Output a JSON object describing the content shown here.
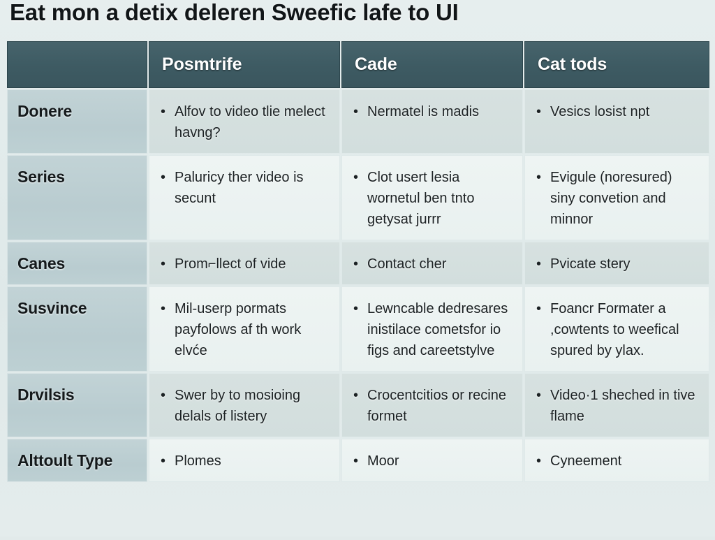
{
  "page": {
    "title": "Eat mon a detix deleren Sweefic lafe to UI",
    "background_color": "#e2eaea",
    "header_color": "#3e5b63",
    "row_label_color": "#bdd0d3",
    "band_dark_color": "#d4e0df",
    "band_light_color": "#ecf3f2"
  },
  "table": {
    "columns": [
      {
        "key": "label",
        "header": ""
      },
      {
        "key": "col1",
        "header": "Posmtrife"
      },
      {
        "key": "col2",
        "header": "Cade"
      },
      {
        "key": "col3",
        "header": "Cat tods"
      }
    ],
    "rows": [
      {
        "label": "Donere",
        "col1": [
          "Alfov to video tlie melect havng?"
        ],
        "col2": [
          "Nermatel is madis"
        ],
        "col3": [
          "Vesics losist npt"
        ]
      },
      {
        "label": "Series",
        "col1": [
          "Paluricy ther video is secunt"
        ],
        "col2": [
          "Clot usert lesia wornetul ben tnto getysat jurrr"
        ],
        "col3": [
          "Evigule (noresured) siny convetion and minnor"
        ]
      },
      {
        "label": "Canes",
        "col1": [
          "Prom⌐llect of vide"
        ],
        "col2": [
          "Contact cher"
        ],
        "col3": [
          "Pvicate stery"
        ]
      },
      {
        "label": "Susvince",
        "col1": [
          "Mil-userp pormats payfolows af th work elvće"
        ],
        "col2": [
          "Lewncable dedresares inistilace cometsfor io figs and careetstylve"
        ],
        "col3": [
          "Foancr Formater a ,cowtents to weefical spured by ylax."
        ]
      },
      {
        "label": "Drvilsis",
        "col1": [
          "Swer by to mosioing delals of listery"
        ],
        "col2": [
          "Crocentcitios or recine formet"
        ],
        "col3": [
          "Video·1 sheched in tive flame"
        ]
      },
      {
        "label": "Alttoult Type",
        "col1": [
          "Plomes"
        ],
        "col2": [
          "Moor"
        ],
        "col3": [
          "Cyneement"
        ]
      }
    ]
  }
}
